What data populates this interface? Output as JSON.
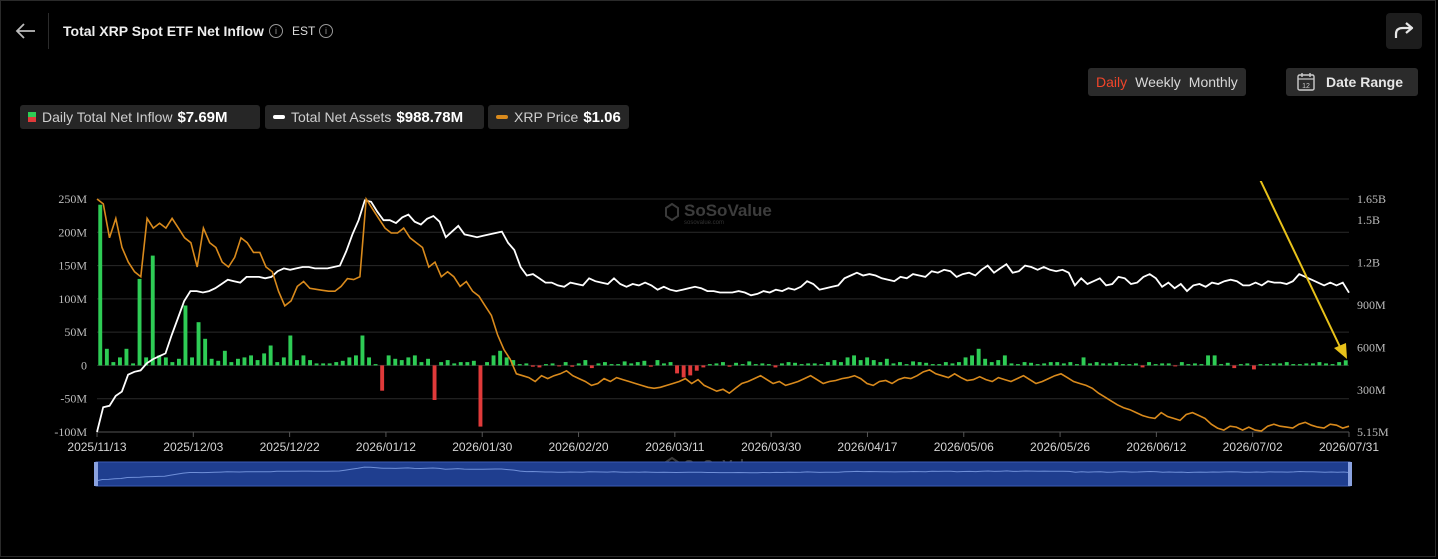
{
  "header": {
    "title": "Total XRP Spot ETF Net Inflow",
    "timezone": "EST",
    "info_glyph": "i",
    "icons": [
      "back-arrow-icon",
      "info-icon",
      "share-icon",
      "calendar-icon"
    ]
  },
  "period_tabs": [
    {
      "label": "Daily",
      "active": true
    },
    {
      "label": "Weekly",
      "active": false
    },
    {
      "label": "Monthly",
      "active": false
    }
  ],
  "date_range": {
    "label": "Date Range",
    "calendar_day": "12"
  },
  "legend": {
    "inflow": {
      "label": "Daily Total Net Inflow",
      "value": "$7.69M"
    },
    "assets": {
      "label": "Total Net Assets",
      "value": "$988.78M"
    },
    "price": {
      "label": "XRP Price",
      "value": "$1.06"
    }
  },
  "watermark": {
    "text": "SoSoValue",
    "sub": "sosovalue.com"
  },
  "colors": {
    "positive": "#2ecc55",
    "negative": "#e03a3a",
    "assets_line": "#ffffff",
    "price_line": "#d98a1c",
    "navigator": "#1f3e8f",
    "annotation": "#e8c21a",
    "active_tab": "#f0452a"
  },
  "chart_data": {
    "type": "bar",
    "left_axis": {
      "ticks": [
        "250M",
        "200M",
        "150M",
        "100M",
        "50M",
        "0",
        "-50M",
        "-100M"
      ],
      "range": [
        -100,
        250
      ],
      "unit": "M"
    },
    "right_axis": {
      "ticks": [
        "1.65B",
        "1.5B",
        "1.2B",
        "900M",
        "600M",
        "300M",
        "5.15M"
      ],
      "range": [
        5.15,
        1650
      ],
      "unit": "M"
    },
    "x_ticks": [
      "2025/11/13",
      "2025/12/03",
      "2025/12/22",
      "2026/01/12",
      "2026/01/30",
      "2026/02/20",
      "2026/03/11",
      "2026/03/30",
      "2026/04/17",
      "2026/05/06",
      "2026/05/26",
      "2026/06/12",
      "2026/07/02",
      "2026/07/31"
    ],
    "x_range": [
      "2025/11/13",
      "2026/07/31"
    ],
    "series": [
      {
        "name": "Daily Total Net Inflow",
        "type": "bar",
        "axis": "left",
        "unit": "M",
        "values": [
          241.5,
          25,
          5,
          12,
          25,
          3,
          130,
          12,
          165,
          15,
          12,
          5,
          10,
          90,
          12,
          65,
          40,
          10,
          7,
          22,
          5,
          10,
          12,
          15,
          8,
          18,
          30,
          5,
          12,
          45,
          8,
          15,
          8,
          3,
          3,
          3,
          5,
          7,
          12,
          15,
          45,
          12,
          2,
          -38,
          15,
          10,
          8,
          12,
          15,
          5,
          10,
          -52,
          5,
          8,
          3,
          5,
          5,
          7,
          -92,
          5,
          15,
          22,
          12,
          8,
          2,
          3,
          -2,
          -3,
          2,
          3,
          -1,
          5,
          -2,
          3,
          8,
          -4,
          3,
          5,
          2,
          2,
          6,
          3,
          5,
          7,
          -2,
          8,
          3,
          5,
          -12,
          -18,
          -15,
          -8,
          -3,
          2,
          3,
          5,
          -2,
          4,
          2,
          6,
          2,
          3,
          2,
          -3,
          3,
          5,
          4,
          2,
          3,
          3,
          2,
          5,
          8,
          5,
          12,
          15,
          8,
          12,
          8,
          5,
          10,
          3,
          5,
          2,
          6,
          5,
          4,
          2,
          2,
          5,
          3,
          5,
          12,
          15,
          25,
          10,
          5,
          8,
          15,
          3,
          2,
          5,
          4,
          2,
          3,
          5,
          5,
          3,
          5,
          2,
          12,
          3,
          5,
          3,
          3,
          5,
          2,
          2,
          3,
          -3,
          5,
          2,
          3,
          3,
          -1,
          5,
          2,
          3,
          2,
          15,
          15,
          2,
          4,
          -4,
          2,
          3,
          -6,
          2,
          2,
          3,
          3,
          5,
          2,
          2,
          3,
          3,
          5,
          3,
          2,
          5,
          7.69
        ]
      },
      {
        "name": "Total Net Assets",
        "type": "line",
        "axis": "right",
        "unit": "M",
        "values": [
          5.15,
          180,
          190,
          260,
          290,
          410,
          430,
          440,
          490,
          520,
          540,
          560,
          690,
          810,
          930,
          1000,
          1000,
          990,
          1000,
          1020,
          1050,
          1080,
          1070,
          1060,
          1100,
          1100,
          1100,
          1090,
          1100,
          1140,
          1160,
          1150,
          1160,
          1170,
          1170,
          1160,
          1160,
          1160,
          1170,
          1180,
          1280,
          1400,
          1500,
          1640,
          1630,
          1560,
          1500,
          1500,
          1480,
          1520,
          1540,
          1490,
          1470,
          1510,
          1530,
          1490,
          1380,
          1420,
          1460,
          1400,
          1390,
          1380,
          1390,
          1400,
          1410,
          1420,
          1340,
          1290,
          1170,
          1110,
          1120,
          1090,
          1060,
          1060,
          1040,
          1030,
          1060,
          1050,
          1040,
          1090,
          1070,
          1060,
          1050,
          1090,
          1050,
          1030,
          1050,
          1040,
          1060,
          1040,
          1010,
          1030,
          1010,
          1000,
          1010,
          1020,
          1030,
          1020,
          1000,
          1000,
          990,
          990,
          990,
          1000,
          990,
          970,
          980,
          1000,
          990,
          1010,
          1000,
          1020,
          1010,
          1030,
          1070,
          1050,
          1010,
          1020,
          1030,
          1040,
          1090,
          1110,
          1130,
          1110,
          1120,
          1110,
          1090,
          1080,
          1070,
          1100,
          1090,
          1120,
          1110,
          1100,
          1140,
          1130,
          1150,
          1140,
          1100,
          1120,
          1130,
          1110,
          1150,
          1180,
          1130,
          1160,
          1190,
          1130,
          1140,
          1180,
          1170,
          1150,
          1170,
          1150,
          1140,
          1150,
          1130,
          1040,
          1090,
          1050,
          1070,
          1090,
          1040,
          1050,
          1100,
          1090,
          1050,
          1060,
          1100,
          1120,
          1090,
          1030,
          1060,
          1020,
          1050,
          1000,
          1040,
          1050,
          1030,
          1060,
          1050,
          1070,
          1080,
          1070,
          1040,
          1040,
          1060,
          1040,
          1070,
          1060,
          1060,
          1050,
          1070,
          1120,
          1100,
          1080,
          1060,
          1040,
          1060,
          1040,
          1060,
          988.78
        ]
      },
      {
        "name": "XRP Price",
        "type": "line",
        "axis": "right",
        "unit": "$",
        "values": [
          2.5,
          2.45,
          2.1,
          2.3,
          2.0,
          1.85,
          1.75,
          1.7,
          2.3,
          2.2,
          2.25,
          2.2,
          2.3,
          2.2,
          2.1,
          2.05,
          1.8,
          2.2,
          2.05,
          2.0,
          1.85,
          1.8,
          1.9,
          2.1,
          2.05,
          1.95,
          1.95,
          1.8,
          1.75,
          1.55,
          1.4,
          1.45,
          1.6,
          1.65,
          1.58,
          1.57,
          1.56,
          1.55,
          1.55,
          1.6,
          1.68,
          1.67,
          1.7,
          2.5,
          2.4,
          2.3,
          2.2,
          2.15,
          2.15,
          2.2,
          2.1,
          2.05,
          2.0,
          1.8,
          1.85,
          1.7,
          1.75,
          1.7,
          1.6,
          1.65,
          1.55,
          1.5,
          1.4,
          1.3,
          1.1,
          0.95,
          0.85,
          0.7,
          0.68,
          0.66,
          0.62,
          0.68,
          0.65,
          0.68,
          0.7,
          0.73,
          0.68,
          0.65,
          0.62,
          0.58,
          0.6,
          0.65,
          0.62,
          0.66,
          0.64,
          0.62,
          0.6,
          0.58,
          0.56,
          0.55,
          0.56,
          0.58,
          0.6,
          0.62,
          0.65,
          0.6,
          0.64,
          0.58,
          0.55,
          0.52,
          0.54,
          0.5,
          0.55,
          0.6,
          0.62,
          0.65,
          0.68,
          0.64,
          0.6,
          0.62,
          0.58,
          0.6,
          0.62,
          0.65,
          0.68,
          0.64,
          0.6,
          0.62,
          0.63,
          0.65,
          0.66,
          0.68,
          0.65,
          0.6,
          0.58,
          0.62,
          0.63,
          0.6,
          0.64,
          0.66,
          0.65,
          0.68,
          0.72,
          0.74,
          0.7,
          0.68,
          0.66,
          0.7,
          0.66,
          0.63,
          0.64,
          0.67,
          0.64,
          0.62,
          0.66,
          0.64,
          0.62,
          0.65,
          0.68,
          0.64,
          0.6,
          0.62,
          0.65,
          0.68,
          0.7,
          0.66,
          0.62,
          0.6,
          0.58,
          0.55,
          0.5,
          0.46,
          0.42,
          0.38,
          0.35,
          0.33,
          0.3,
          0.27,
          0.25,
          0.24,
          0.3,
          0.26,
          0.24,
          0.22,
          0.28,
          0.3,
          0.27,
          0.24,
          0.18,
          0.14,
          0.12,
          0.16,
          0.15,
          0.12,
          0.15,
          0.12,
          0.11,
          0.16,
          0.18,
          0.16,
          0.15,
          0.14,
          0.18,
          0.2,
          0.17,
          0.15,
          0.14,
          0.18,
          0.17,
          0.14,
          0.16
        ]
      }
    ],
    "legend_placement": "top-left",
    "grid": true
  }
}
